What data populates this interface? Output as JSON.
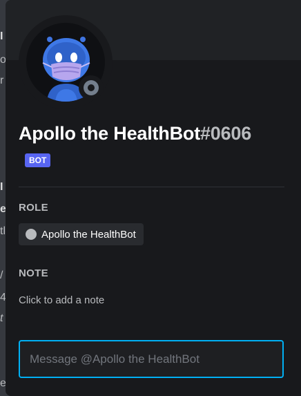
{
  "background_glyphs": [
    "I",
    "o",
    "r",
    "I",
    "e",
    "tl",
    "/",
    "4",
    "t",
    "e"
  ],
  "profile": {
    "username": "Apollo the HealthBot",
    "discriminator": "#0606",
    "bot_tag": "BOT",
    "avatar_icon": "robot-mask-icon",
    "status": "offline",
    "status_color": "#747f8d"
  },
  "role_section": {
    "title": "ROLE",
    "roles": [
      {
        "name": "Apollo the HealthBot",
        "color": "#b9bbbe"
      }
    ]
  },
  "note_section": {
    "title": "NOTE",
    "placeholder": "Click to add a note"
  },
  "message": {
    "placeholder": "Message @Apollo the HealthBot",
    "value": ""
  },
  "colors": {
    "accent": "#5865f2",
    "focus_border": "#00b0f4",
    "popout_bg": "#18191c",
    "banner_bg": "#202225"
  }
}
